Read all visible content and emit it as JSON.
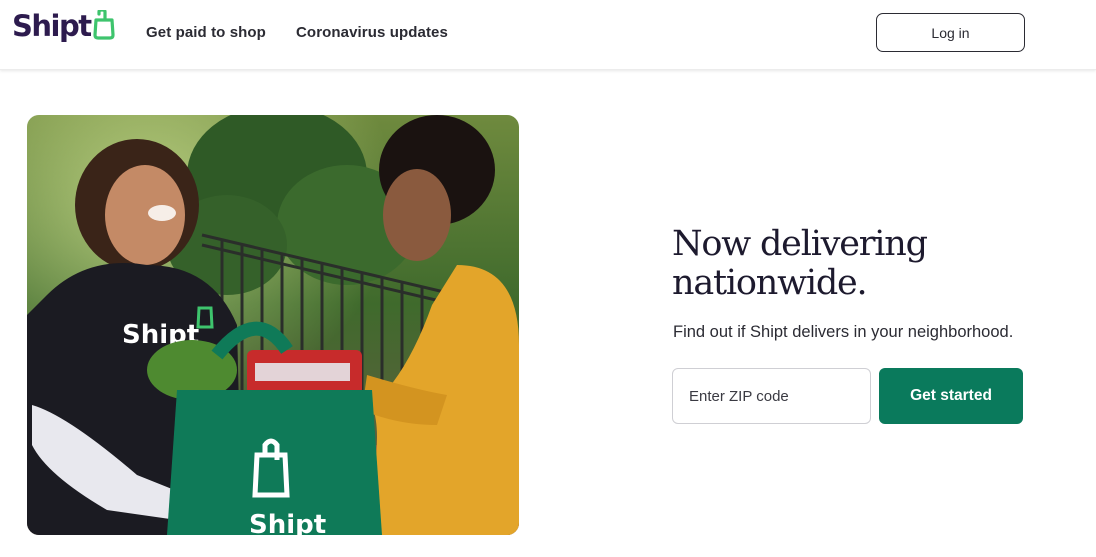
{
  "header": {
    "logo_text": "Shipt",
    "nav": [
      "Get paid to shop",
      "Coronavirus updates"
    ],
    "login_label": "Log in"
  },
  "hero": {
    "image_alt": "Shipt shopper handing a grocery bag to a customer",
    "shirt_text": "Shipt",
    "bag_text": "Shipt"
  },
  "signup": {
    "headline_line1": "Now delivering",
    "headline_line2": "nationwide.",
    "subtext": "Find out if Shipt delivers in your neighborhood.",
    "zip_placeholder": "Enter ZIP code",
    "cta_label": "Get started"
  },
  "colors": {
    "brand_purple": "#2d1b4e",
    "brand_green": "#0a7a5c",
    "logo_bag_green": "#3ec46d"
  }
}
